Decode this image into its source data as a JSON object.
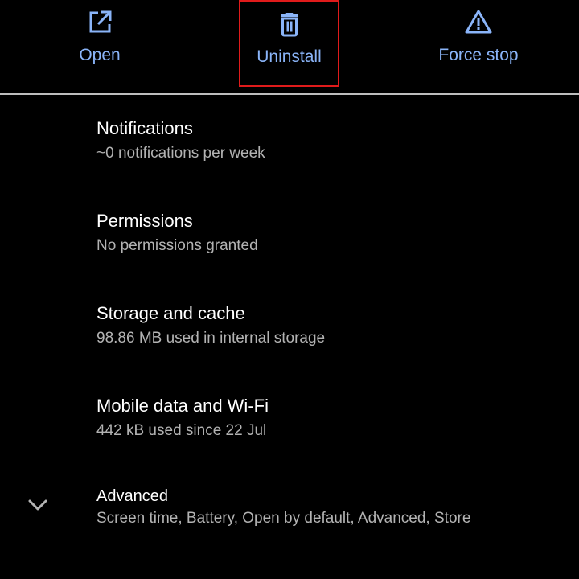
{
  "colors": {
    "background": "#000000",
    "accent": "#8ab4f8",
    "title_text": "#ffffff",
    "summary_text": "#b3b3b3",
    "divider": "#bdbdbd",
    "highlight_box": "#e01b1b"
  },
  "action_bar": {
    "open": {
      "label": "Open",
      "icon": "open-in-new-icon"
    },
    "uninstall": {
      "label": "Uninstall",
      "icon": "trash-icon"
    },
    "force_stop": {
      "label": "Force stop",
      "icon": "warning-icon"
    }
  },
  "settings": {
    "notifications": {
      "title": "Notifications",
      "summary": "~0 notifications per week"
    },
    "permissions": {
      "title": "Permissions",
      "summary": "No permissions granted"
    },
    "storage": {
      "title": "Storage and cache",
      "summary": "98.86 MB used in internal storage"
    },
    "mobile_data": {
      "title": "Mobile data and Wi-Fi",
      "summary": "442 kB used since 22 Jul"
    },
    "advanced": {
      "title": "Advanced",
      "summary": "Screen time, Battery, Open by default, Advanced, Store",
      "icon": "chevron-down-icon"
    }
  }
}
